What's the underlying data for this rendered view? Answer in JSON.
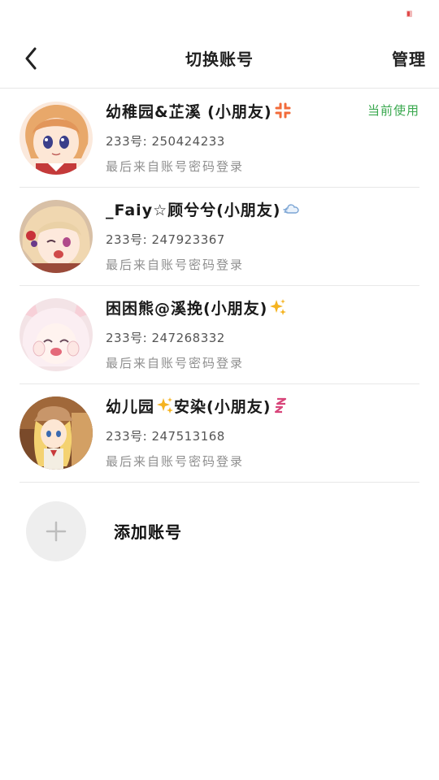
{
  "header": {
    "title": "切换账号",
    "manage_label": "管理"
  },
  "accounts": [
    {
      "name": "幼稚园&芷溪 (小朋友)",
      "emoji": "anger-symbol",
      "id_text": "233号: 250424233",
      "login_info": "最后来自账号密码登录",
      "current_label": "当前使用"
    },
    {
      "name": "_Faiy☆顾兮兮(小朋友)",
      "emoji": "dash-cloud",
      "id_text": "233号: 247923367",
      "login_info": "最后来自账号密码登录"
    },
    {
      "name": "困困熊@溪挽(小朋友)",
      "emoji": "sparkles",
      "id_text": "233号: 247268332",
      "login_info": "最后来自账号密码登录"
    },
    {
      "name": "幼儿园",
      "name_suffix": "安染(小朋友)",
      "emoji": "zzz",
      "id_text": "233号: 247513168",
      "login_info": "最后来自账号密码登录"
    }
  ],
  "add_account": {
    "label": "添加账号"
  },
  "colors": {
    "accent_green": "#39a84e",
    "divider": "#e8e8e8",
    "add_circle_bg": "#eeeeee"
  }
}
